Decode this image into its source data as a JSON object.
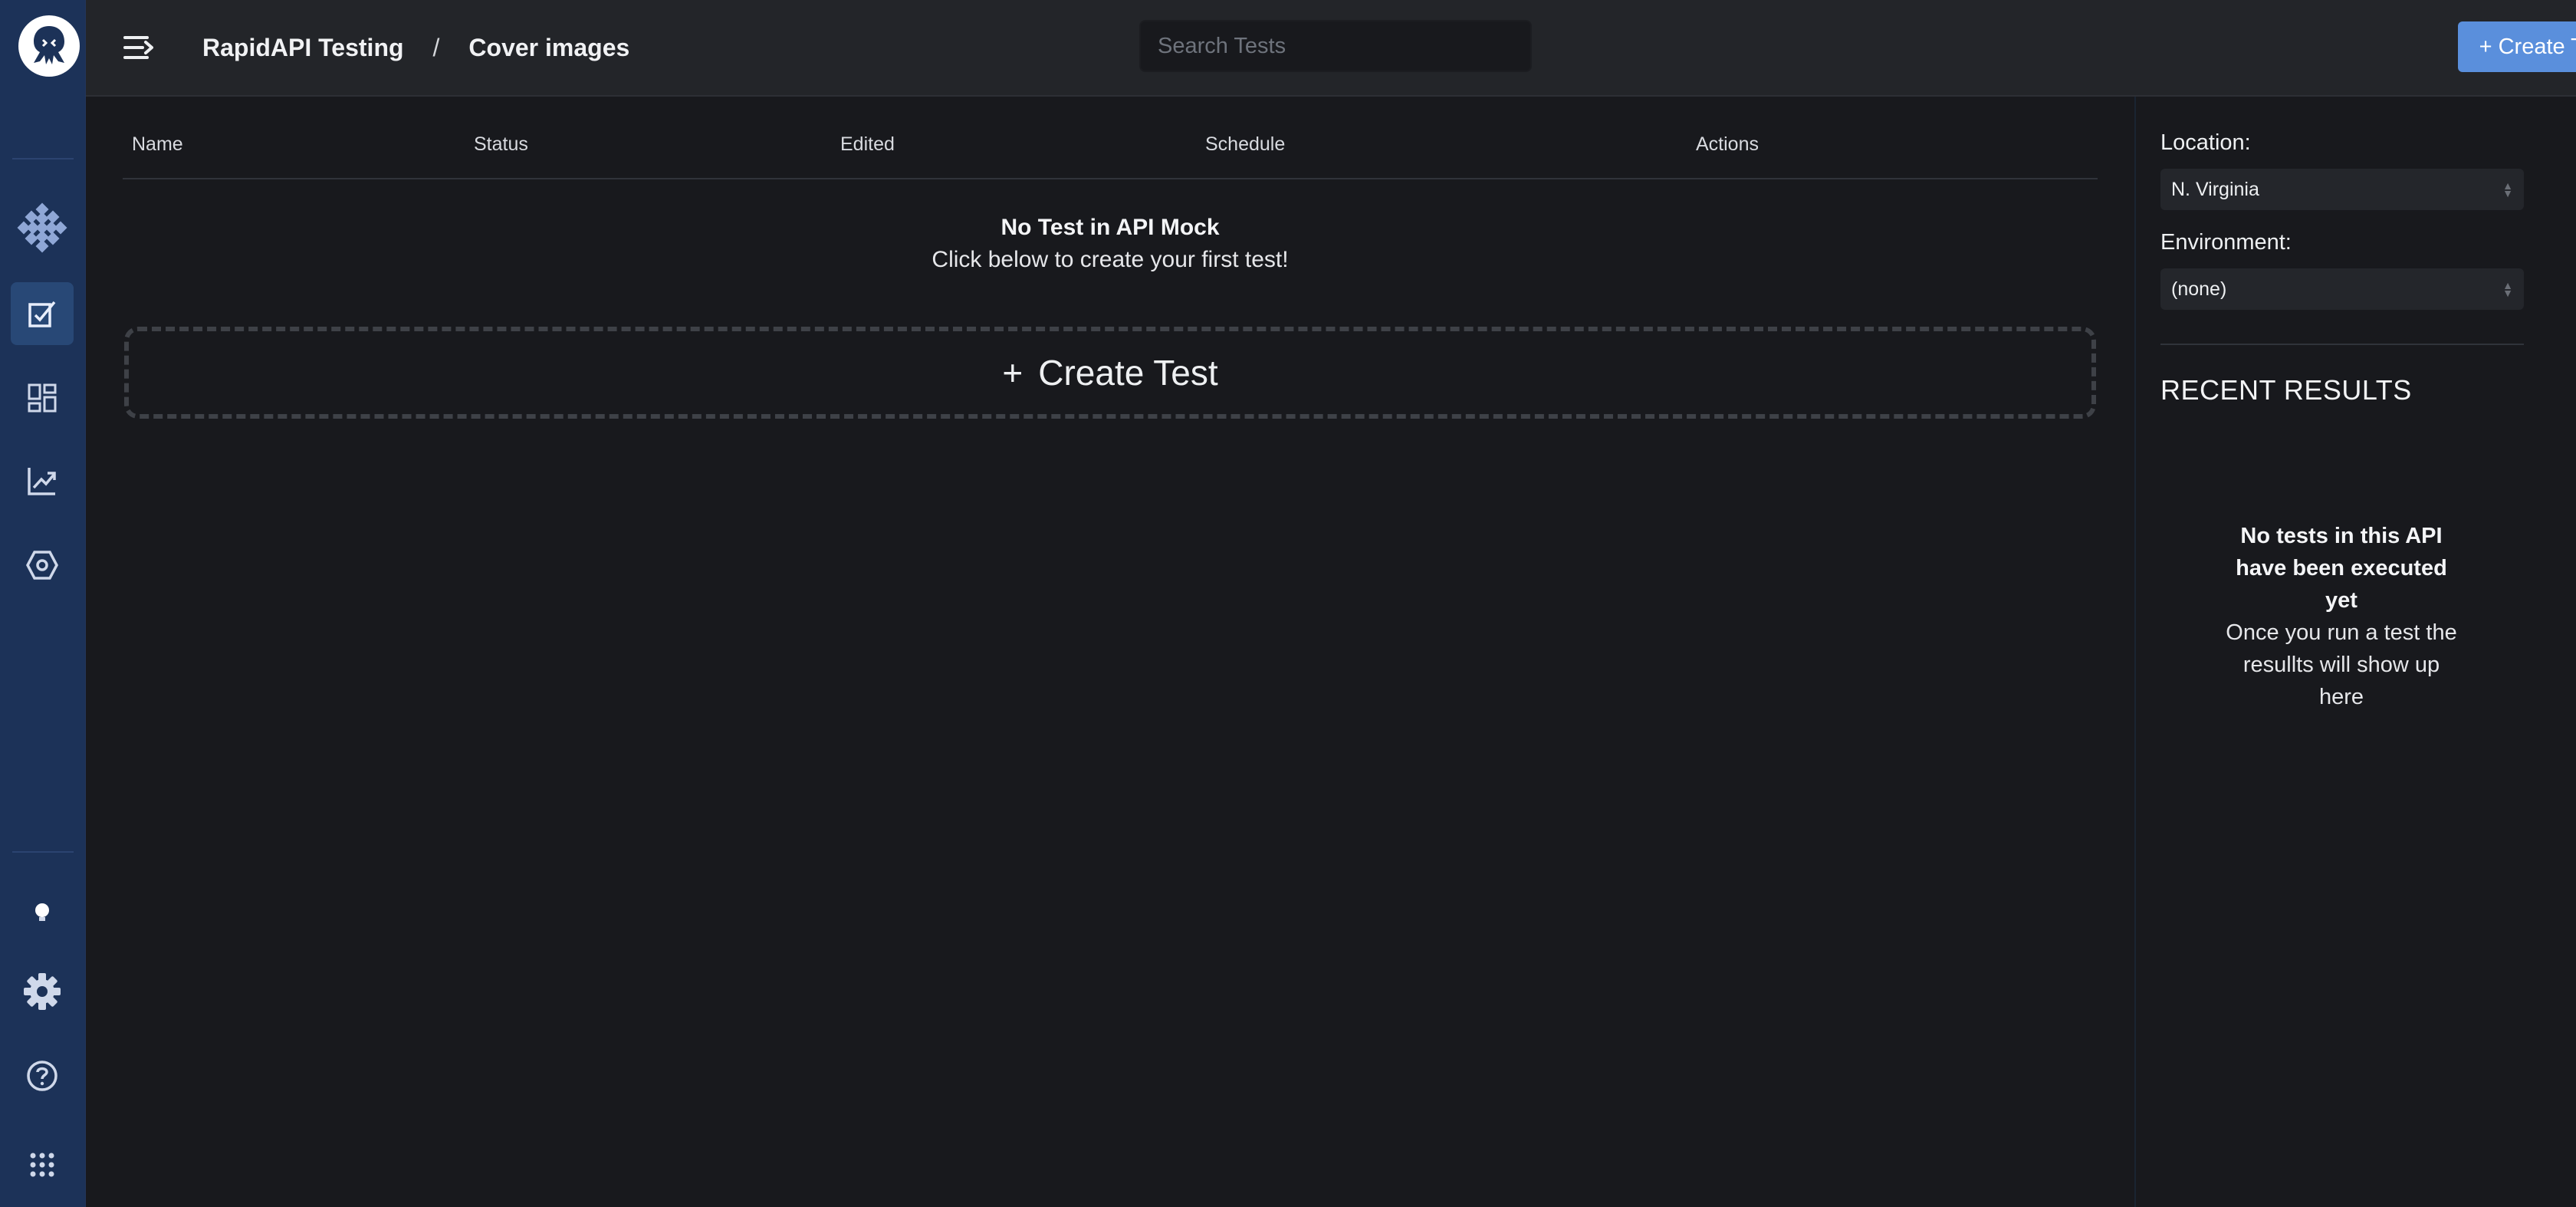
{
  "nav": {
    "items": [
      "home-icon",
      "tests-icon",
      "dashboard-icon",
      "analytics-icon",
      "settings-hex-icon"
    ],
    "bottom": [
      "lightbulb-icon",
      "gear-icon",
      "help-icon",
      "apps-grid-icon"
    ]
  },
  "header": {
    "breadcrumb": [
      "RapidAPI Testing",
      "Cover images"
    ],
    "separator": "/",
    "search_placeholder": "Search Tests",
    "create_button": "+ Create Test",
    "accent": "#5a8fdc"
  },
  "table": {
    "columns": [
      "Name",
      "Status",
      "Edited",
      "Schedule",
      "Actions"
    ],
    "empty_title": "No Test in API Mock",
    "empty_subtitle": "Click below to create your first test!",
    "create_plus": "+",
    "create_label": "Create Test"
  },
  "panel": {
    "location_label": "Location:",
    "location_value": "N. Virginia",
    "environment_label": "Environment:",
    "environment_value": "(none)",
    "recent_title": "RECENT RESULTS",
    "empty_title": "No tests in this API have been executed yet",
    "empty_subtitle": "Once you run a test the resullts will show up here"
  }
}
